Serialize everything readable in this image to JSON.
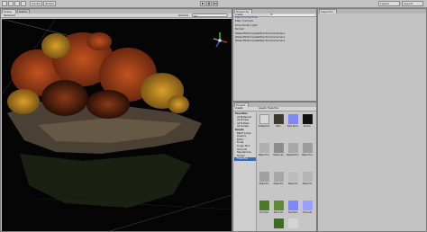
{
  "toolbar": {
    "tools": [
      "hand-tool",
      "move-tool",
      "rotate-tool",
      "scale-tool"
    ],
    "pivot_label": "Center",
    "space_label": "Global",
    "layers_label": "Layers",
    "layout_label": "Layout"
  },
  "scene": {
    "tab_scene": "Scene",
    "tab_game": "Game",
    "shading_mode": "Textured",
    "gizmos_label": "Gizmos",
    "search_placeholder": "All"
  },
  "hierarchy": {
    "tab": "Hierarchy",
    "create_label": "Create",
    "search_placeholder": "All",
    "items": [
      "Main/Profile/Tree",
      "Main Camera",
      "Directional Light",
      "Terrain",
      "WaterHDSimpleRefl/ect/mainCamera",
      "WaterHDSimpleRefl/ect/mainCamera",
      "WaterHDSimpleRefl/ect/mainCamera"
    ]
  },
  "project": {
    "tab": "Project",
    "create_label": "Create",
    "breadcrumb": [
      "Assets",
      "Trees Ess"
    ],
    "tree": [
      "Favorites",
      "All Materials",
      "All Models",
      "All Prefabs",
      "All Scripts",
      "",
      "Assets",
      "BRDF sampl",
      "Dreamy",
      "Editor",
      "Fruits",
      "Fungy Tech",
      "Grounds",
      "Standard As",
      "Terrain",
      "Trees Ess"
    ],
    "assets": [
      "Ambient Oc",
      "Bark",
      "Bark Norm",
      "Branch",
      "Maple Trun",
      "Maple Lea",
      "Maple Norm",
      "Maple Trun",
      "Maple Pre",
      "Maple Pre",
      "Maple Tre",
      "Maple Tre",
      "Pine Tree",
      "Shrub Tre",
      "Tree Bark",
      "Tree Leaf"
    ]
  },
  "inspector": {
    "tab": "Inspector"
  },
  "colors": {
    "panel": "#c6c6c6",
    "viewport": "#050505",
    "foliage_orange": "#b4501e",
    "foliage_yellow": "#c8961e",
    "gizmo_x": "#d23232",
    "gizmo_y": "#4ac832",
    "gizmo_z": "#2c5ae0"
  }
}
